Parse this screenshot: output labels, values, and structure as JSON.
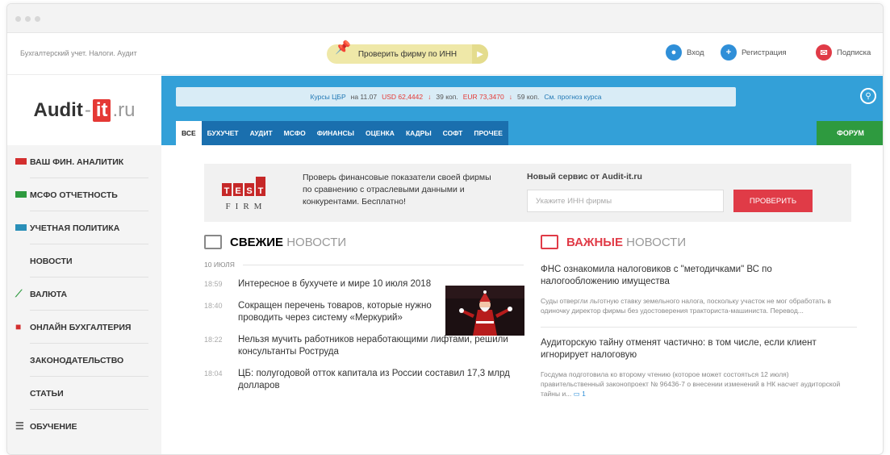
{
  "topbar": {
    "tagline": "Бухгалтерский учет. Налоги. Аудит",
    "check_inn": "Проверить фирму по ИНН",
    "login": "Вход",
    "register": "Регистрация",
    "subscribe": "Подписка"
  },
  "logo": {
    "part1": "Audit",
    "dash": "-",
    "part2": "it",
    "part3": ".ru"
  },
  "rates": {
    "label": "Курсы ЦБР",
    "date": "на 11.07",
    "usd": "USD 62,4442",
    "usd_change": "39 коп.",
    "eur": "EUR 73,3470",
    "eur_change": "59 коп.",
    "forecast": "См. прогноз курса"
  },
  "tabs": [
    "ВСЕ",
    "БУХУЧЕТ",
    "АУДИТ",
    "МСФО",
    "ФИНАНСЫ",
    "ОЦЕНКА",
    "КАДРЫ",
    "СОФТ",
    "ПРОЧЕЕ"
  ],
  "forum": "ФОРУМ",
  "sidebar": [
    {
      "label": "ВАШ ФИН. АНАЛИТИК",
      "color": "#d32f2f"
    },
    {
      "label": "МСФО ОТЧЕТНОСТЬ",
      "color": "#2e9a3f"
    },
    {
      "label": "УЧЕТНАЯ ПОЛИТИКА",
      "color": "#2a8fb8"
    },
    {
      "label": "НОВОСТИ",
      "color": ""
    },
    {
      "label": "ВАЛЮТА",
      "color": "#2e9a3f"
    },
    {
      "label": "ОНЛАЙН БУХГАЛТЕРИЯ",
      "color": "#d32f2f"
    },
    {
      "label": "ЗАКОНОДАТЕЛЬСТВО",
      "color": ""
    },
    {
      "label": "СТАТЬИ",
      "color": ""
    },
    {
      "label": "ОБУЧЕНИЕ",
      "color": "#555"
    }
  ],
  "promo": {
    "logo_top": "TEST",
    "logo_bottom": "FIRM",
    "text": "Проверь финансовые показатели своей фирмы по сравнению с отраслевыми данными и конкурентами. Бесплатно!",
    "title": "Новый сервис от Audit-it.ru",
    "placeholder": "Укажите ИНН фирмы",
    "button": "ПРОВЕРИТЬ"
  },
  "fresh": {
    "bold": "СВЕЖИЕ",
    "light": "НОВОСТИ",
    "date": "10 ИЮЛЯ",
    "items": [
      {
        "time": "18:59",
        "text": "Интересное в бухучете и мире 10 июля 2018"
      },
      {
        "time": "18:40",
        "text": "Сокращен перечень товаров, которые нужно проводить через систему «Меркурий»"
      },
      {
        "time": "18:22",
        "text": "Нельзя мучить работников неработающими лифтами, решили консультанты Роструда"
      },
      {
        "time": "18:04",
        "text": "ЦБ: полугодовой отток капитала из России составил 17,3 млрд долларов"
      }
    ]
  },
  "important": {
    "bold": "ВАЖНЫЕ",
    "light": "НОВОСТИ",
    "items": [
      {
        "title": "ФНС ознакомила налоговиков с \"методичками\" ВС по налогообложению имущества",
        "desc": "Суды отвергли льготную ставку земельного налога, поскольку участок не мог обработать в одиночку директор фирмы без удостоверения тракториста-машиниста. Перевод..."
      },
      {
        "title": "Аудиторскую тайну отменят частично: в том числе, если клиент игнорирует налоговую",
        "desc": "Госдума подготовила ко второму чтению (которое может состояться 12 июля) правительственный законопроект № 96436-7 о внесении изменений в НК насчет аудиторской тайны и...",
        "comments": "1"
      }
    ]
  }
}
